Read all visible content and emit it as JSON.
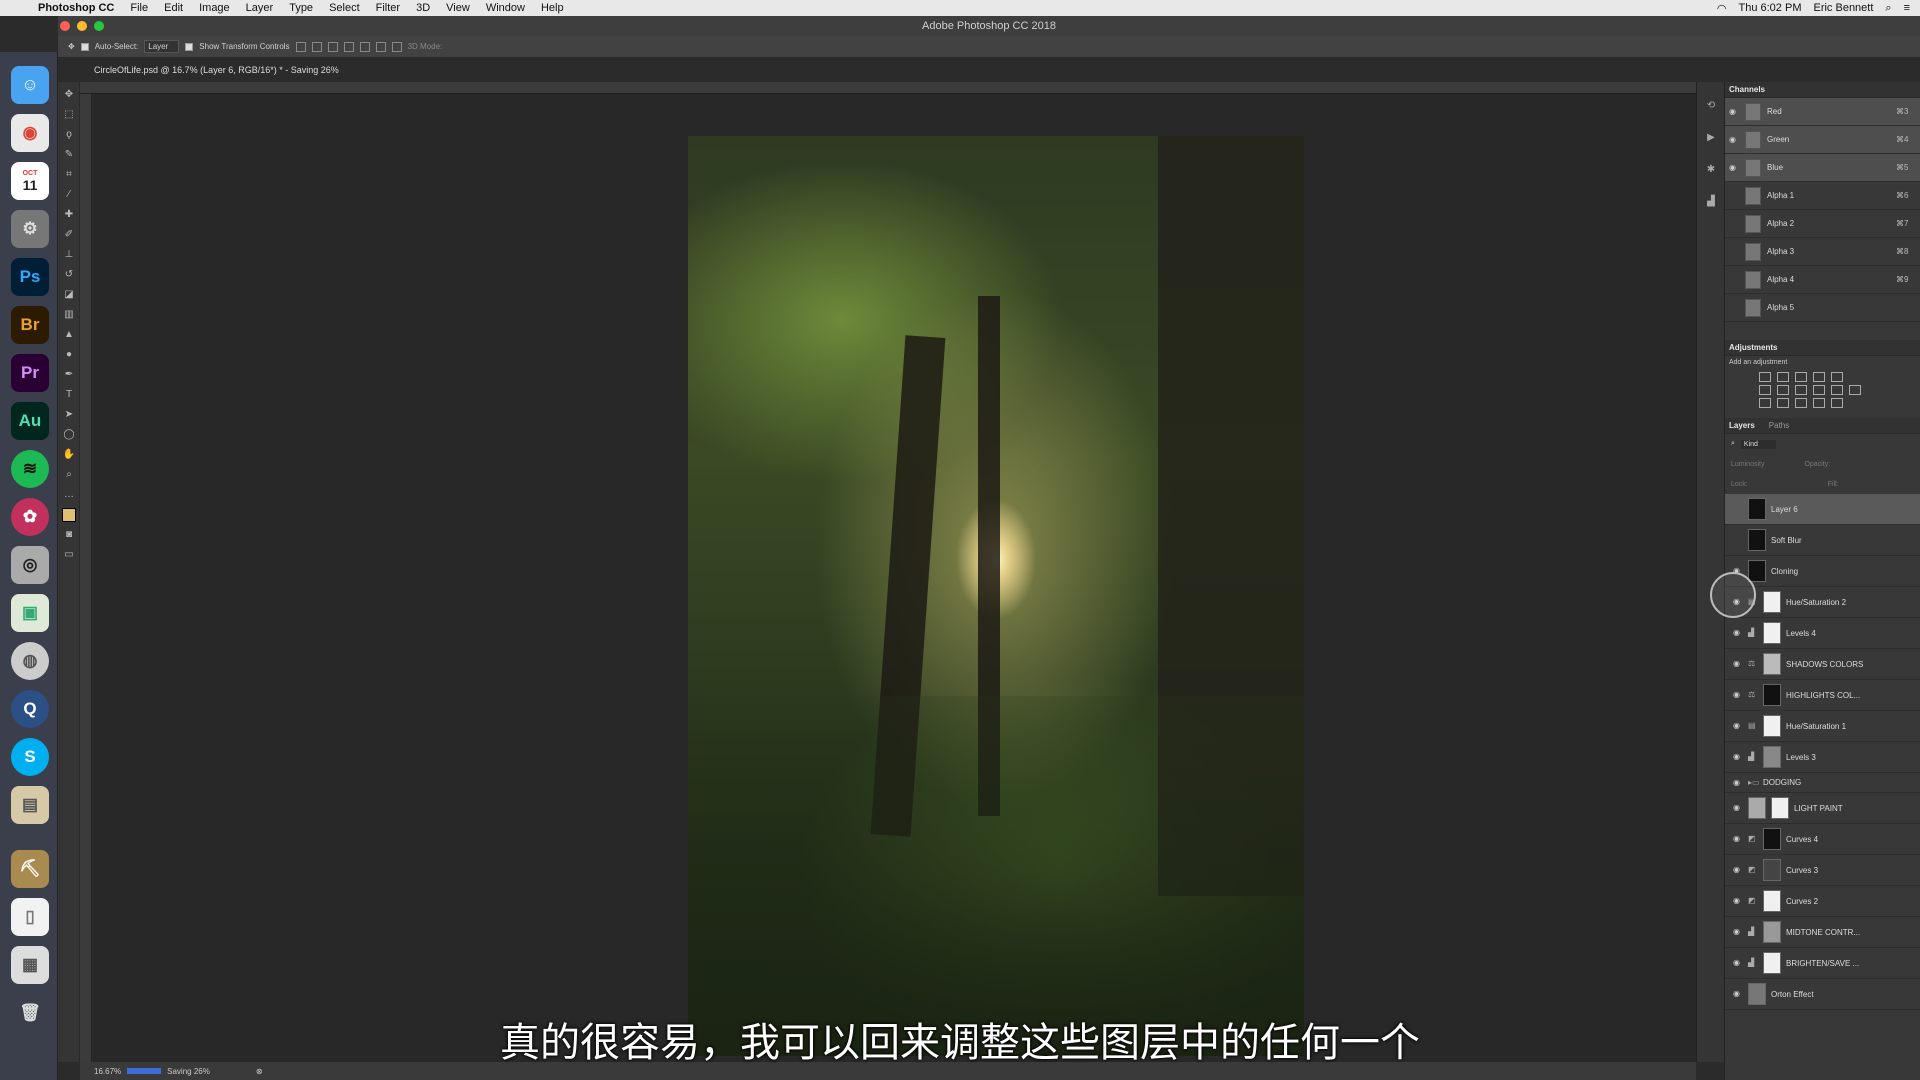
{
  "menubar": {
    "app_name": "Photoshop CC",
    "items": [
      "File",
      "Edit",
      "Image",
      "Layer",
      "Type",
      "Select",
      "Filter",
      "3D",
      "View",
      "Window",
      "Help"
    ],
    "clock": "Thu 6:02 PM",
    "user": "Eric Bennett"
  },
  "window": {
    "title": "Adobe Photoshop CC 2018"
  },
  "options": {
    "auto_select_label": "Auto-Select:",
    "auto_select_value": "Layer",
    "transform_label": "Show Transform Controls",
    "mode_3d": "3D Mode:"
  },
  "document": {
    "tab_title": "CircleOfLife.psd @ 16.7% (Layer 6, RGB/16*) * - Saving 26%"
  },
  "status": {
    "zoom": "16.67%",
    "saving": "Saving 26%"
  },
  "dock": {
    "calendar_month": "OCT",
    "calendar_day": "11",
    "apps": [
      "Ps",
      "Br",
      "Pr",
      "Au"
    ]
  },
  "channels": {
    "title": "Channels",
    "rows": [
      {
        "name": "Red",
        "shortcut": "⌘3"
      },
      {
        "name": "Green",
        "shortcut": "⌘4"
      },
      {
        "name": "Blue",
        "shortcut": "⌘5"
      },
      {
        "name": "Alpha 1",
        "shortcut": "⌘6"
      },
      {
        "name": "Alpha 2",
        "shortcut": "⌘7"
      },
      {
        "name": "Alpha 3",
        "shortcut": "⌘8"
      },
      {
        "name": "Alpha 4",
        "shortcut": "⌘9"
      },
      {
        "name": "Alpha 5",
        "shortcut": ""
      }
    ]
  },
  "adjustments": {
    "title": "Adjustments",
    "subtitle": "Add an adjustment"
  },
  "layers": {
    "tabs": [
      "Layers",
      "Paths"
    ],
    "kind_label": "Kind",
    "blend_mode": "Luminosity",
    "opacity_label": "Opacity:",
    "lock_label": "Lock:",
    "fill_label": "Fill:",
    "rows": [
      {
        "name": "Layer 6"
      },
      {
        "name": "Soft Blur"
      },
      {
        "name": "Cloning"
      },
      {
        "name": "Hue/Saturation 2"
      },
      {
        "name": "Levels 4"
      },
      {
        "name": "SHADOWS COLORS"
      },
      {
        "name": "HIGHLIGHTS COL..."
      },
      {
        "name": "Hue/Saturation 1"
      },
      {
        "name": "Levels 3"
      },
      {
        "name": "DODGING"
      },
      {
        "name": "LIGHT PAINT"
      },
      {
        "name": "Curves 4"
      },
      {
        "name": "Curves 3"
      },
      {
        "name": "Curves 2"
      },
      {
        "name": "MIDTONE CONTR..."
      },
      {
        "name": "BRIGHTEN/SAVE ..."
      },
      {
        "name": "Orton Effect"
      }
    ]
  },
  "subtitle": "真的很容易，我可以回来调整这些图层中的任何一个"
}
